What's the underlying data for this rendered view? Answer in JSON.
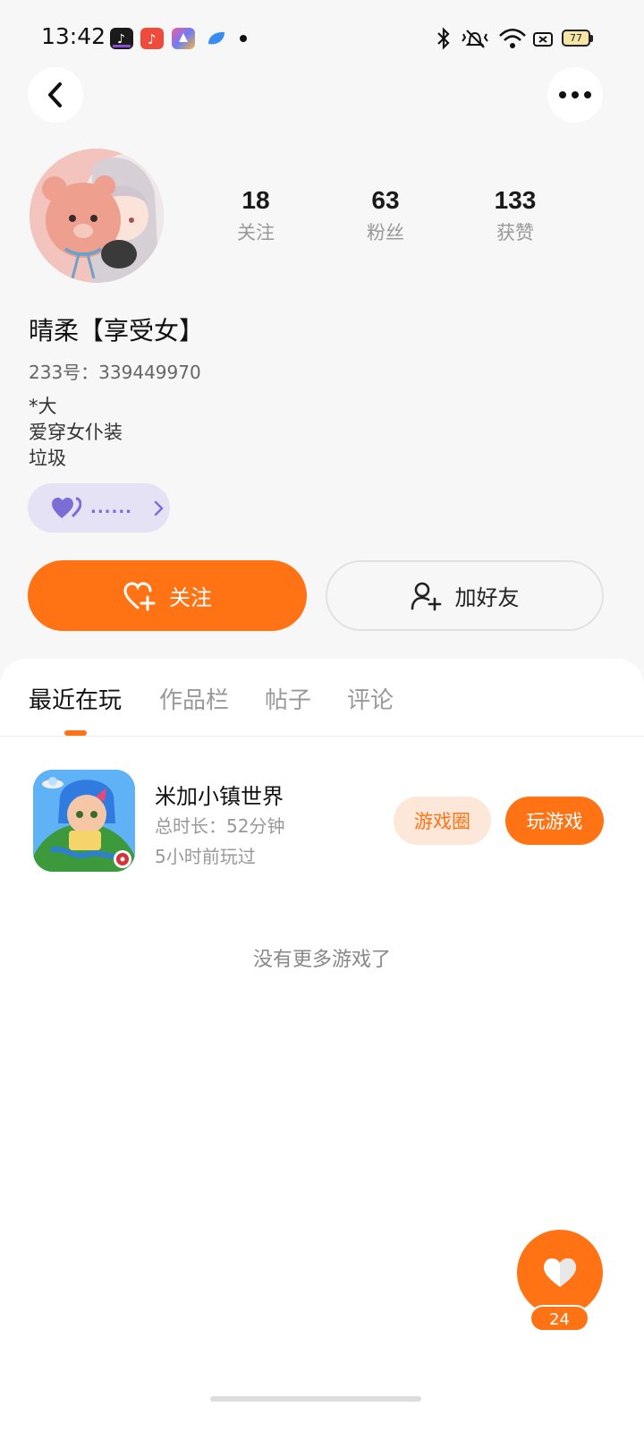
{
  "status_bar": {
    "time": "13:42",
    "battery": "77",
    "notification_icons": [
      "tiktok-icon",
      "music-icon",
      "shortcut-icon",
      "browser-icon"
    ],
    "system_icons": [
      "bluetooth-icon",
      "vibrate-icon",
      "wifi-icon",
      "sim-icon",
      "battery-icon"
    ]
  },
  "header": {
    "back_icon": "chevron-left-icon",
    "more_icon": "more-horizontal-icon"
  },
  "profile": {
    "nickname": "晴柔【享受女】",
    "uid": "233号：339449970",
    "bio_lines": [
      "*大",
      "爱穿女仆装",
      "垃圾"
    ],
    "stats": [
      {
        "value": "18",
        "label": "关注"
      },
      {
        "value": "63",
        "label": "粉丝"
      },
      {
        "value": "133",
        "label": "获赞"
      }
    ],
    "tag_text": "......",
    "tag_icon": "heart-icon"
  },
  "actions": {
    "follow_label": "关注",
    "add_friend_label": "加好友"
  },
  "tabs": [
    "最近在玩",
    "作品栏",
    "帖子",
    "评论"
  ],
  "games": [
    {
      "title": "米加小镇世界",
      "total_time": "总时长：52分钟",
      "last_played": "5小时前玩过",
      "circle_label": "游戏圈",
      "play_label": "玩游戏"
    }
  ],
  "footer_text": "没有更多游戏了",
  "fab": {
    "count": "24",
    "icon": "heart-icon"
  },
  "colors": {
    "accent": "#ff7314",
    "tag_bg": "#e5e2f6",
    "tag_fg": "#7b6cd6"
  }
}
